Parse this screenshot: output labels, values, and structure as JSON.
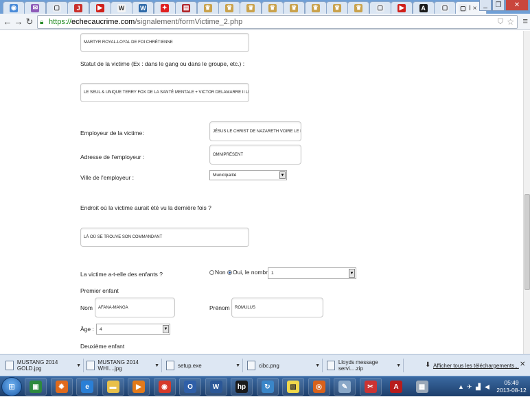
{
  "browser": {
    "tabs": [
      {
        "icon": "chrome-page-icon",
        "color": "#4a8bd8",
        "glyph": "◉"
      },
      {
        "icon": "mail-icon",
        "color": "#8e5bb8",
        "glyph": "✉"
      },
      {
        "icon": "blank-page-icon",
        "color": "#e8ecf2",
        "glyph": "▢"
      },
      {
        "icon": "script-j-icon",
        "color": "#c9302c",
        "glyph": "J"
      },
      {
        "icon": "youtube-icon",
        "color": "#d0201a",
        "glyph": "▶"
      },
      {
        "icon": "wikipedia-icon",
        "color": "#f4f4f4",
        "glyph": "W"
      },
      {
        "icon": "wordpress-icon",
        "color": "#2f6aa8",
        "glyph": "W"
      },
      {
        "icon": "maple-leaf-icon",
        "color": "#e02020",
        "glyph": "✦"
      },
      {
        "icon": "news-icon",
        "color": "#b0262a",
        "glyph": "▤"
      },
      {
        "icon": "royal-crest-icon",
        "color": "#c9a24c",
        "glyph": "♛"
      },
      {
        "icon": "royal-crest-icon",
        "color": "#c9a24c",
        "glyph": "♛"
      },
      {
        "icon": "royal-crest-icon",
        "color": "#c9a24c",
        "glyph": "♛"
      },
      {
        "icon": "royal-crest-icon",
        "color": "#c9a24c",
        "glyph": "♛"
      },
      {
        "icon": "royal-crest-icon",
        "color": "#c9a24c",
        "glyph": "♛"
      },
      {
        "icon": "royal-crest-icon",
        "color": "#c9a24c",
        "glyph": "♛"
      },
      {
        "icon": "royal-crest-icon",
        "color": "#c9a24c",
        "glyph": "♛"
      },
      {
        "icon": "royal-crest-icon",
        "color": "#c9a24c",
        "glyph": "♛"
      },
      {
        "icon": "blank-page-icon",
        "color": "#e8ecf2",
        "glyph": "▢"
      },
      {
        "icon": "youtube-icon",
        "color": "#d0201a",
        "glyph": "▶"
      },
      {
        "icon": "android-icon",
        "color": "#1a1a1a",
        "glyph": "A"
      },
      {
        "icon": "blank-page-icon",
        "color": "#e8ecf2",
        "glyph": "▢"
      }
    ],
    "active_tab_label": "l",
    "url_scheme": "https://",
    "url_host": "echecaucrime.com",
    "url_path": "/signalement/formVictime_2.php"
  },
  "form": {
    "field_title_value": "MARTYR ROYAL-LOYAL DE FOI CHRÉTIENNE",
    "statut_label": "Statut de la victime (Ex : dans le gang ou dans le groupe, etc.) :",
    "statut_value": "LE SEUL & UNIQUE TERRY FOX DE LA SANTÉ MENTALE + VICTOR DELAMARRE II LE ROI",
    "employeur_label": "Employeur de la victime:",
    "employeur_value": "JÉSUS LE CHRIST DE NAZARETH VOIRE LE FIL",
    "adresse_label": "Adresse de l'employeur :",
    "adresse_value": "OMNIPRÉSENT",
    "ville_label": "Ville de l'employeur :",
    "ville_value": "Municipalité",
    "endroit_label": "Endroit où la victime aurait été vu la dernière fois ?",
    "endroit_value": "LÀ OÙ SE TROUVE SON COMMANDANT",
    "enfants_label": "La victime a-t-elle des enfants ?",
    "radio_non": "Non",
    "radio_oui": "Oui, le nombre",
    "nombre_value": "1",
    "premier_enfant": "Premier enfant",
    "nom_label": "Nom :",
    "nom_value": "AFANA-MANGA",
    "prenom_label": "Prénom :",
    "prenom_value": "ROMULUS",
    "age_label": "Âge :",
    "age_value": "4",
    "deuxieme_enfant": "Deuxième enfant"
  },
  "downloads": {
    "items": [
      {
        "name": "MUSTANG 2014 GOLD.jpg"
      },
      {
        "name": "MUSTANG 2014 WHI....jpg"
      },
      {
        "name": "setup.exe"
      },
      {
        "name": "cibc.png"
      },
      {
        "name": "Lloyds message servi....zip"
      }
    ],
    "show_all": "Afficher tous les téléchargements..."
  },
  "taskbar": {
    "apps": [
      {
        "icon": "media-center-icon",
        "color": "#2d8a3e",
        "glyph": "▣"
      },
      {
        "icon": "firefox-flame-icon",
        "color": "#e06a1c",
        "glyph": "✹"
      },
      {
        "icon": "internet-explorer-icon",
        "color": "#2a7fd6",
        "glyph": "e"
      },
      {
        "icon": "folder-icon",
        "color": "#e8c04a",
        "glyph": "▬"
      },
      {
        "icon": "media-player-icon",
        "color": "#e37a1a",
        "glyph": "▶"
      },
      {
        "icon": "chrome-icon",
        "color": "#d63a2a",
        "glyph": "◉"
      },
      {
        "icon": "outlook-icon",
        "color": "#2f5fa8",
        "glyph": "O"
      },
      {
        "icon": "word-icon",
        "color": "#2b5797",
        "glyph": "W"
      },
      {
        "icon": "hp-icon",
        "color": "#1a1a1a",
        "glyph": "hp"
      },
      {
        "icon": "sync-icon",
        "color": "#3a86c8",
        "glyph": "↻"
      },
      {
        "icon": "sticky-notes-icon",
        "color": "#f0d84a",
        "glyph": "▧"
      },
      {
        "icon": "firefox-icon",
        "color": "#d8611a",
        "glyph": "◎"
      },
      {
        "icon": "paint-icon",
        "color": "#8aa8c8",
        "glyph": "✎"
      },
      {
        "icon": "scissors-icon",
        "color": "#cc3333",
        "glyph": "✂"
      },
      {
        "icon": "acrobat-icon",
        "color": "#b71c1c",
        "glyph": "A"
      },
      {
        "icon": "calculator-icon",
        "color": "#9aa8b8",
        "glyph": "▦"
      }
    ],
    "time": "05:49",
    "date": "2013-08-12"
  }
}
